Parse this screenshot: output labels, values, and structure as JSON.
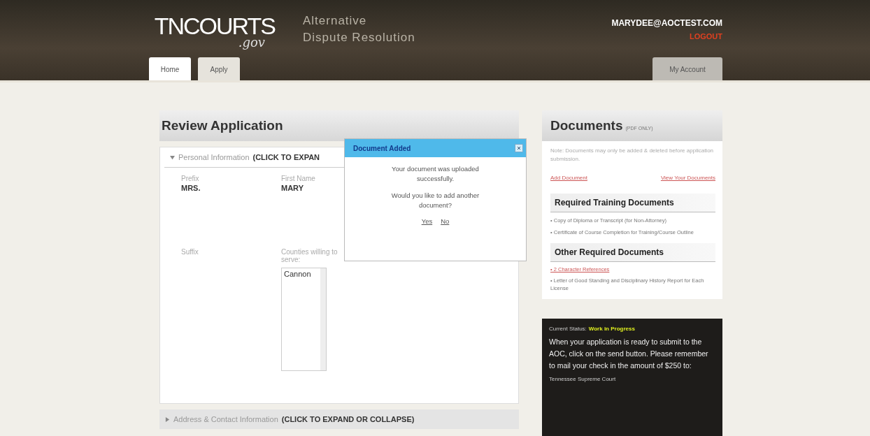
{
  "header": {
    "logo": {
      "main": "TNCOURTS",
      "sub": ".gov"
    },
    "site_title": [
      "Alternative",
      "Dispute Resolution"
    ],
    "user_email": "MARYDEE@AOCTEST.COM",
    "logout": "LOGOUT"
  },
  "tabs": [
    {
      "label": "Home",
      "selected": true
    },
    {
      "label": "Apply",
      "selected": false
    }
  ],
  "account_tab": {
    "label": "My Account",
    "selected": false
  },
  "review": {
    "title": "Review Application",
    "sections": [
      {
        "label": "Personal Information",
        "hint": "(CLICK TO EXPAN",
        "expanded": true
      },
      {
        "label": "Address & Contact Information",
        "hint": "(CLICK TO EXPAND OR COLLAPSE)",
        "expanded": false
      }
    ],
    "fields": [
      {
        "label": "Prefix",
        "value": "MRS."
      },
      {
        "label": "First Name",
        "value": "MARY"
      }
    ],
    "suffix_label": "Suffix",
    "counties": {
      "label": "Counties willing to serve:",
      "options": [
        "Cannon"
      ]
    }
  },
  "dialog": {
    "title": "Document Added",
    "message": "Your document was uploaded successfully.",
    "question": "Would you like to add another document?",
    "buttons": [
      "Yes",
      "No"
    ]
  },
  "documents": {
    "title": "Documents",
    "title_note": "(PDF ONLY)",
    "note": "Note: Documents may only be added & deleted before application submission.",
    "links": [
      "Add Document",
      "View Your Documents"
    ],
    "groups": [
      {
        "title": "Required Training Documents",
        "items": [
          {
            "text": "• Copy of Diploma or Transcript (for Non-Attorney)",
            "link": false
          },
          {
            "text": "• Certificate of Course Completion for Training/Course Outline",
            "link": false
          }
        ]
      },
      {
        "title": "Other Required Documents",
        "items": [
          {
            "text": "• 2 Character References",
            "link": true
          },
          {
            "text": "• Letter of Good Standing and Disciplinary History Report for Each License",
            "link": false
          }
        ]
      }
    ]
  },
  "status": {
    "label": "Current Status:",
    "value": "Work in Progress",
    "message": "When your application is ready to submit to the AOC, click on the send button. Please remember to mail your check in the amount of $250 to:",
    "address": "Tennessee Supreme Court"
  }
}
